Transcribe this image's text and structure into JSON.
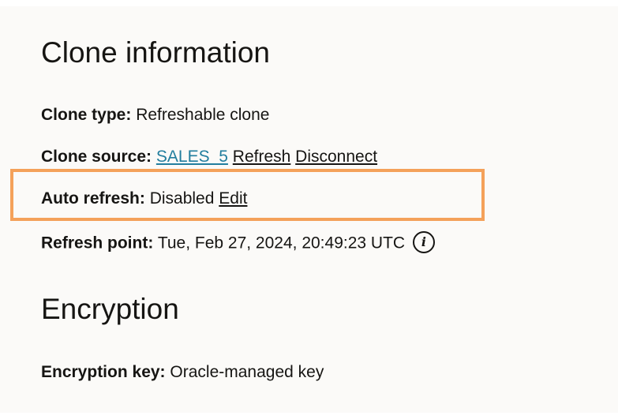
{
  "clone_info": {
    "title": "Clone information",
    "type_label": "Clone type:",
    "type_value": "Refreshable clone",
    "source_label": "Clone source:",
    "source_link": "SALES_5",
    "refresh_link": "Refresh",
    "disconnect_link": "Disconnect",
    "auto_refresh_label": "Auto refresh:",
    "auto_refresh_value": "Disabled",
    "edit_link": "Edit",
    "refresh_point_label": "Refresh point:",
    "refresh_point_value": "Tue, Feb 27, 2024, 20:49:23 UTC",
    "info_icon_glyph": "i"
  },
  "encryption": {
    "title": "Encryption",
    "key_label": "Encryption key:",
    "key_value": "Oracle-managed key"
  },
  "colors": {
    "link_primary": "#227e9e",
    "highlight_border": "#f4a15a",
    "panel_bg": "#fbfaf8",
    "text": "#161513"
  },
  "icons": {
    "info": "info-circle-icon"
  }
}
